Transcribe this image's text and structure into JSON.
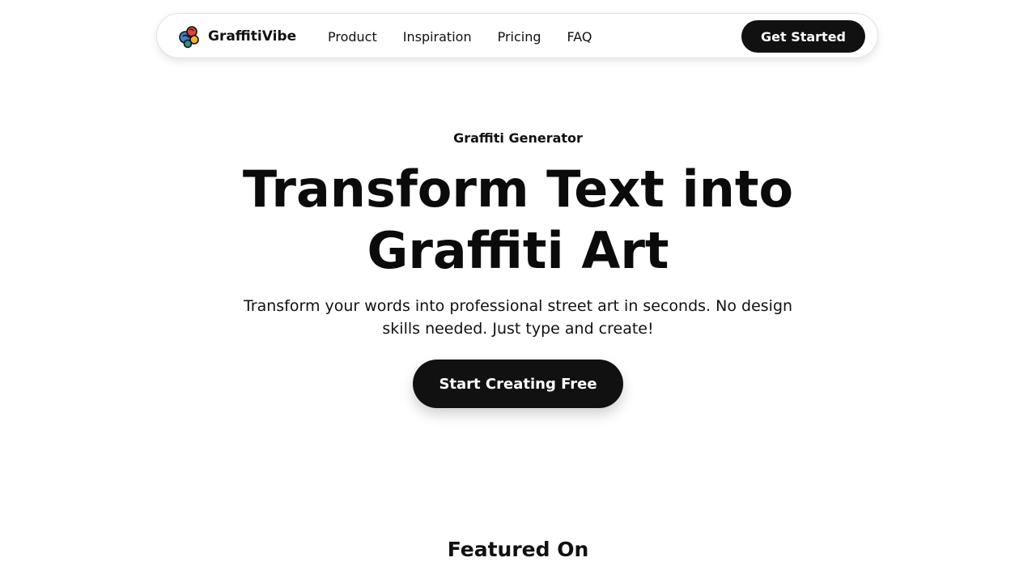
{
  "nav": {
    "brand_name": "GraffitiVibe",
    "links": [
      {
        "label": "Product"
      },
      {
        "label": "Inspiration"
      },
      {
        "label": "Pricing"
      },
      {
        "label": "FAQ"
      }
    ],
    "cta_label": "Get Started"
  },
  "hero": {
    "eyebrow": "Graffiti Generator",
    "headline": "Transform Text into Graffiti Art",
    "subhead": "Transform your words into professional street art in seconds. No design skills needed. Just type and create!",
    "cta_label": "Start Creating Free"
  },
  "featured": {
    "title": "Featured On"
  },
  "icons": {
    "logo": "graffiti-swirl-logo-icon"
  },
  "colors": {
    "primary": "#111111",
    "background": "#ffffff",
    "logo_red": "#e0453a",
    "logo_yellow": "#f2b134",
    "logo_blue": "#3f7fc1",
    "logo_teal": "#2f8f8a"
  }
}
